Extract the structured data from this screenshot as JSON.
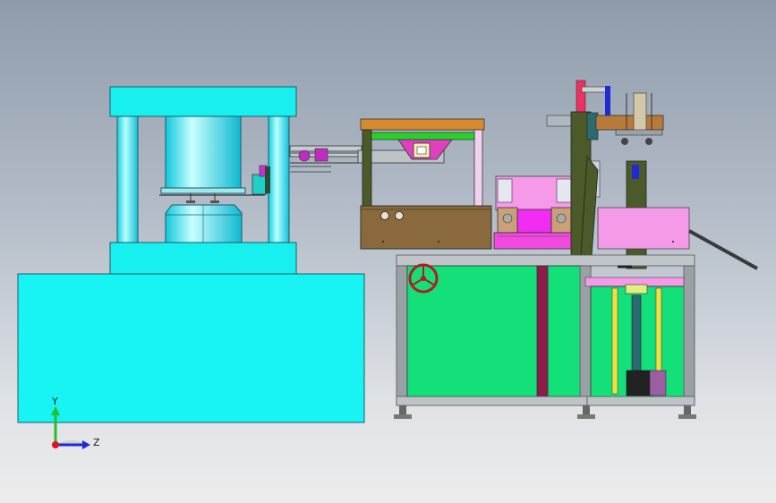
{
  "triad": {
    "y_label": "Y",
    "z_label": "Z",
    "colors": {
      "y": "#22c02a",
      "z": "#1d2ad6",
      "x": "#e0151b"
    }
  },
  "colors": {
    "cyan": "#18f0f0",
    "green_panel": "#14e07a",
    "frame_grey": "#9da3a6",
    "olive": "#4b5a28",
    "brown": "#8a6a3c",
    "pink": "#f49ae8",
    "magenta": "#f22cf2",
    "maroon": "#8e1c4a",
    "orange": "#d88a2e"
  }
}
